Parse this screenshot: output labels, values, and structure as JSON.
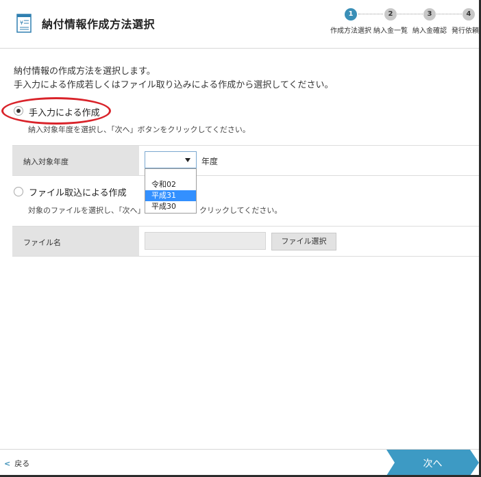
{
  "header": {
    "title": "納付情報作成方法選択",
    "steps": [
      {
        "num": "1",
        "label": "作成方法選択",
        "active": true
      },
      {
        "num": "2",
        "label": "納入金一覧",
        "active": false
      },
      {
        "num": "3",
        "label": "納入金確認",
        "active": false
      },
      {
        "num": "4",
        "label": "発行依頼完",
        "active": false
      }
    ]
  },
  "intro": {
    "line1": "納付情報の作成方法を選択します。",
    "line2": "手入力による作成若しくはファイル取り込みによる作成から選択してください。"
  },
  "manual": {
    "label": "手入力による作成",
    "description": "納入対象年度を選択し、「次へ」ボタンをクリックしてください。",
    "selected": true,
    "year_label": "納入対象年度",
    "year_value": "",
    "year_suffix": "年度",
    "year_options": [
      "令和02",
      "平成31",
      "平成30"
    ],
    "highlighted_option": "平成31"
  },
  "file": {
    "label": "ファイル取込による作成",
    "description_left": "対象のファイルを選択し、「次へ」",
    "description_right": "クリックしてください。",
    "selected": false,
    "file_label": "ファイル名",
    "file_value": "",
    "select_button": "ファイル選択"
  },
  "footer": {
    "back_label": "戻る",
    "next_label": "次へ"
  },
  "colors": {
    "accent": "#3a8fb7",
    "next_button": "#3d9ac4",
    "highlight_ring": "#d9232a",
    "dropdown_selected": "#3390ff"
  }
}
